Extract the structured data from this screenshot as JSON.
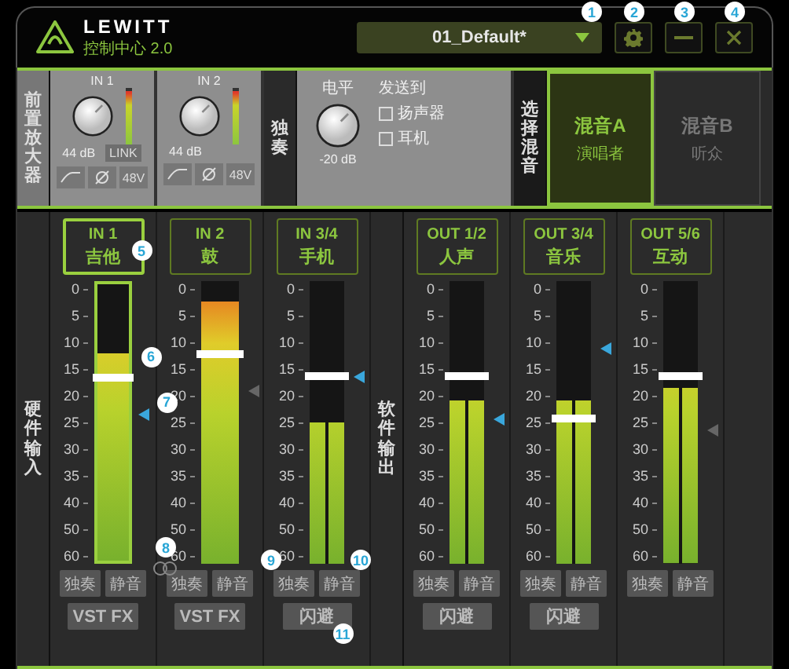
{
  "header": {
    "logo": {
      "brand": "LEWITT",
      "product": "控制中心 2.0"
    },
    "preset": {
      "value": "01_Default*",
      "callout": "1"
    },
    "settings_button": {
      "callout": "2"
    },
    "minimize_button": {
      "callout": "3"
    },
    "close_button": {
      "callout": "4"
    }
  },
  "preamp": {
    "label": "前置放大器",
    "channels": [
      {
        "name": "IN 1",
        "gain": "44 dB",
        "level": 0.95,
        "link": "LINK",
        "phantom": "48V"
      },
      {
        "name": "IN 2",
        "gain": "44 dB",
        "level": 0.95,
        "phantom": "48V"
      }
    ]
  },
  "monitor": {
    "label": "独奏",
    "level_label": "电平",
    "knob_value": "-20 dB",
    "send_label": "发送到",
    "destinations": [
      {
        "label": "扬声器",
        "checked": false
      },
      {
        "label": "耳机",
        "checked": false
      }
    ]
  },
  "mix_select": {
    "label": "选择混音",
    "mixes": [
      {
        "name": "混音A",
        "subtitle": "演唱者",
        "selected": true
      },
      {
        "name": "混音B",
        "subtitle": "听众",
        "selected": false
      }
    ]
  },
  "hardware_inputs": {
    "label": "硬件输入",
    "link_icon": {
      "callout": "8"
    },
    "channels": [
      {
        "name": "IN 1",
        "subtitle": "吉他",
        "selected": true,
        "stereo": false,
        "callout": "5",
        "scale": [
          "0",
          "5",
          "10",
          "15",
          "20",
          "25",
          "30",
          "35",
          "40",
          "50",
          "60"
        ],
        "meter": {
          "level": 0.75
        },
        "fader": {
          "level": 0.66,
          "callout": "6"
        },
        "marker": {
          "level": 0.53,
          "active": true,
          "callout": "7"
        },
        "solo": {
          "label": "独奏"
        },
        "mute": {
          "label": "静音"
        },
        "bottom_button": {
          "label": "VST FX"
        }
      },
      {
        "name": "IN 2",
        "subtitle": "鼓",
        "selected": false,
        "stereo": false,
        "scale": [
          "0",
          "5",
          "10",
          "15",
          "20",
          "25",
          "30",
          "35",
          "40",
          "50",
          "60"
        ],
        "meter": {
          "level": 0.93
        },
        "fader": {
          "level": 0.74
        },
        "marker": {
          "level": 0.61,
          "active": false
        },
        "solo": {
          "label": "独奏"
        },
        "mute": {
          "label": "静音"
        },
        "bottom_button": {
          "label": "VST FX"
        }
      },
      {
        "name": "IN 3/4",
        "subtitle": "手机",
        "selected": false,
        "stereo": true,
        "scale": [
          "0",
          "5",
          "10",
          "15",
          "20",
          "25",
          "30",
          "35",
          "40",
          "50",
          "60"
        ],
        "meter": {
          "level": 0.5
        },
        "fader": {
          "level": 0.66
        },
        "marker": {
          "level": 0.66,
          "active": true
        },
        "solo": {
          "label": "独奏",
          "callout": "9"
        },
        "mute": {
          "label": "静音",
          "callout": "10"
        },
        "bottom_button": {
          "label": "闪避",
          "callout": "11"
        }
      }
    ]
  },
  "software_outputs": {
    "label": "软件输出",
    "channels": [
      {
        "name": "OUT 1/2",
        "subtitle": "人声",
        "selected": false,
        "stereo": true,
        "scale": [
          "0",
          "5",
          "10",
          "15",
          "20",
          "25",
          "30",
          "35",
          "40",
          "50",
          "60"
        ],
        "meter": {
          "level": 0.58
        },
        "fader": {
          "level": 0.66
        },
        "marker": {
          "level": 0.51,
          "active": true
        },
        "solo": {
          "label": "独奏"
        },
        "mute": {
          "label": "静音"
        },
        "bottom_button": {
          "label": "闪避"
        }
      },
      {
        "name": "OUT 3/4",
        "subtitle": "音乐",
        "selected": false,
        "stereo": true,
        "scale": [
          "0",
          "5",
          "10",
          "15",
          "20",
          "25",
          "30",
          "35",
          "40",
          "50",
          "60"
        ],
        "meter": {
          "level": 0.58
        },
        "fader": {
          "level": 0.51
        },
        "marker": {
          "level": 0.76,
          "active": true
        },
        "solo": {
          "label": "独奏"
        },
        "mute": {
          "label": "静音"
        },
        "bottom_button": {
          "label": "闪避"
        }
      },
      {
        "name": "OUT 5/6",
        "subtitle": "互动",
        "selected": false,
        "stereo": true,
        "scale": [
          "0",
          "5",
          "10",
          "15",
          "20",
          "25",
          "30",
          "35",
          "40",
          "50",
          "60"
        ],
        "meter": {
          "level": 0.62
        },
        "fader": {
          "level": 0.66
        },
        "marker": {
          "level": 0.47,
          "active": false
        },
        "solo": {
          "label": "独奏"
        },
        "mute": {
          "label": "静音"
        }
      }
    ]
  }
}
